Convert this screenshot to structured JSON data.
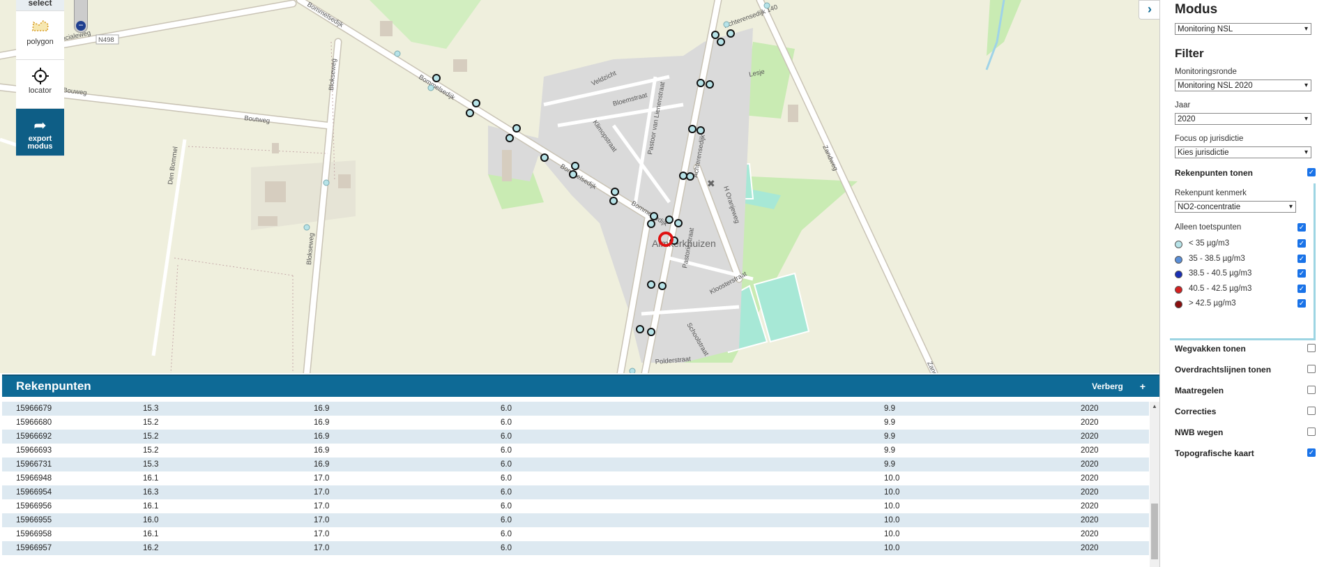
{
  "map": {
    "place_name": "Almkerkhuizen",
    "streets": [
      "Provincialeweg",
      "N498",
      "Bommelsedijk",
      "Bommelsedijk",
      "Bommelsedijk",
      "Bommelsedijk",
      "Bouweg",
      "Boutweg",
      "Blokseweg",
      "Blokseweg",
      "Den Bommel",
      "Veldzicht",
      "Bloemstraat",
      "Klimopstraat",
      "Pastoor van Lienenstraat",
      "Achterensedijk",
      "Achterensedijk",
      "Lesje",
      "Zandweg",
      "H Oranjeweg",
      "Pastoriestraat",
      "Kloosterstraat",
      "Schoolstraat",
      "Polderstraat",
      "Zand"
    ]
  },
  "toolbar": {
    "select_label": "select",
    "polygon_label": "polygon",
    "locator_label": "locator",
    "export_label_1": "export",
    "export_label_2": "modus"
  },
  "panel": {
    "title": "Rekenpunten",
    "hide_label": "Verberg",
    "plus_label": "+",
    "rows": [
      [
        "15966679",
        "15.3",
        "16.9",
        "6.0",
        "9.9",
        "2020"
      ],
      [
        "15966680",
        "15.2",
        "16.9",
        "6.0",
        "9.9",
        "2020"
      ],
      [
        "15966692",
        "15.2",
        "16.9",
        "6.0",
        "9.9",
        "2020"
      ],
      [
        "15966693",
        "15.2",
        "16.9",
        "6.0",
        "9.9",
        "2020"
      ],
      [
        "15966731",
        "15.3",
        "16.9",
        "6.0",
        "9.9",
        "2020"
      ],
      [
        "15966948",
        "16.1",
        "17.0",
        "6.0",
        "10.0",
        "2020"
      ],
      [
        "15966954",
        "16.3",
        "17.0",
        "6.0",
        "10.0",
        "2020"
      ],
      [
        "15966956",
        "16.1",
        "17.0",
        "6.0",
        "10.0",
        "2020"
      ],
      [
        "15966955",
        "16.0",
        "17.0",
        "6.0",
        "10.0",
        "2020"
      ],
      [
        "15966958",
        "16.1",
        "17.0",
        "6.0",
        "10.0",
        "2020"
      ],
      [
        "15966957",
        "16.2",
        "17.0",
        "6.0",
        "10.0",
        "2020"
      ]
    ]
  },
  "sidebar": {
    "modus_title": "Modus",
    "modus_value": "Monitoring NSL",
    "filter_title": "Filter",
    "ronde_label": "Monitoringsronde",
    "ronde_value": "Monitoring NSL 2020",
    "jaar_label": "Jaar",
    "jaar_value": "2020",
    "focus_label": "Focus op jurisdictie",
    "focus_value": "Kies jurisdictie",
    "rekenpunten_label": "Rekenpunten tonen",
    "kenmerk_label": "Rekenpunt kenmerk",
    "kenmerk_value": "NO2-concentratie",
    "toets_label": "Alleen toetspunten",
    "legend": [
      {
        "label": "< 35 µg/m3",
        "color": "#b7e3e8"
      },
      {
        "label": "35 - 38.5 µg/m3",
        "color": "#5a8fd8"
      },
      {
        "label": "38.5 - 40.5 µg/m3",
        "color": "#1a2fb5"
      },
      {
        "label": "40.5 - 42.5 µg/m3",
        "color": "#d42020"
      },
      {
        "label": "> 42.5 µg/m3",
        "color": "#8a0e0e"
      }
    ],
    "layers": [
      {
        "label": "Wegvakken tonen",
        "checked": false
      },
      {
        "label": "Overdrachtslijnen tonen",
        "checked": false
      },
      {
        "label": "Maatregelen",
        "checked": false
      },
      {
        "label": "Correcties",
        "checked": false
      },
      {
        "label": "NWB wegen",
        "checked": false
      },
      {
        "label": "Topografische kaart",
        "checked": true
      }
    ]
  }
}
